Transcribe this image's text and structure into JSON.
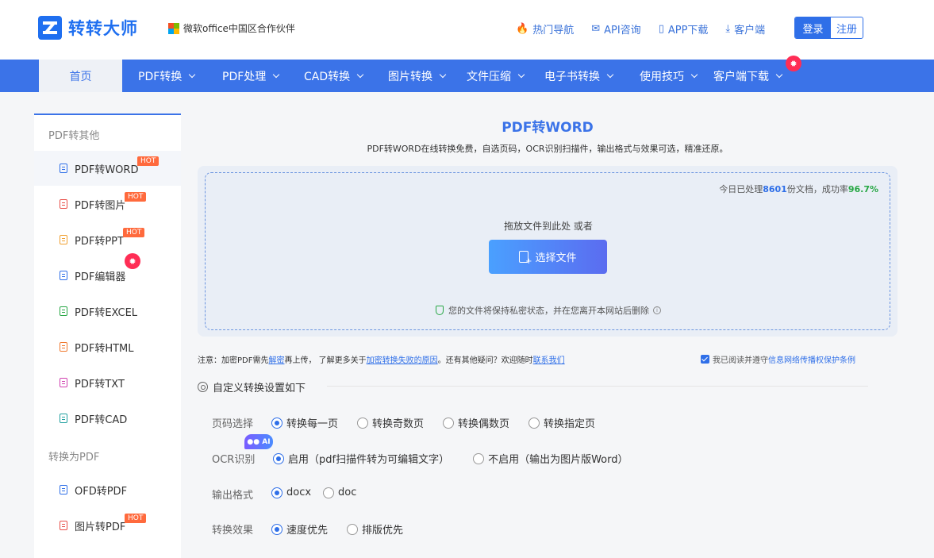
{
  "brand": {
    "name": "转转大师",
    "partner": "微软office中国区合作伙伴"
  },
  "toplinks": [
    {
      "icon": "fire-icon",
      "label": "热门导航"
    },
    {
      "icon": "chat-icon",
      "label": "API咨询"
    },
    {
      "icon": "phone-icon",
      "label": "APP下载"
    },
    {
      "icon": "download-icon",
      "label": "客户端"
    }
  ],
  "auth": {
    "login": "登录",
    "register": "注册"
  },
  "nav": {
    "home": "首页",
    "items": [
      "PDF转换",
      "PDF处理",
      "CAD转换",
      "图片转换",
      "文件压缩",
      "电子书转换",
      "使用技巧",
      "客户端下载"
    ]
  },
  "sidebar": {
    "group1": "PDF转其他",
    "items1": [
      {
        "label": "PDF转WORD",
        "badge": "HOT",
        "color": "#2f6fe8"
      },
      {
        "label": "PDF转图片",
        "badge": "HOT",
        "color": "#e8504a"
      },
      {
        "label": "PDF转PPT",
        "badge": "HOT",
        "color": "#f0a030"
      },
      {
        "label": "PDF编辑器",
        "badge": "fire",
        "color": "#2f6fe8"
      },
      {
        "label": "PDF转EXCEL",
        "badge": "",
        "color": "#28a745"
      },
      {
        "label": "PDF转HTML",
        "badge": "",
        "color": "#f07a30"
      },
      {
        "label": "PDF转TXT",
        "badge": "",
        "color": "#d040b0"
      },
      {
        "label": "PDF转CAD",
        "badge": "",
        "color": "#20a0a0"
      }
    ],
    "group2": "转换为PDF",
    "items2": [
      {
        "label": "OFD转PDF",
        "badge": "",
        "color": "#2f6fe8"
      },
      {
        "label": "图片转PDF",
        "badge": "HOT",
        "color": "#e8504a"
      }
    ]
  },
  "main": {
    "title": "PDF转WORD",
    "subtitle": "PDF转WORD在线转换免费，自选页码，OCR识别扫描件，输出格式与效果可选，精准还原。",
    "stats": {
      "prefix": "今日已处理",
      "count": "8601",
      "mid": "份文档，成功率",
      "rate": "96.7%"
    },
    "drop_text": "拖放文件到此处 或者",
    "choose_button": "选择文件",
    "privacy": "您的文件将保持私密状态，并在您离开本网站后删除",
    "notice": {
      "p1": "注意：加密PDF需先",
      "link1": "解密",
      "p2": "再上传， 了解更多关于",
      "link2": "加密转换失败的原因",
      "p3": "。还有其他疑问？欢迎随时",
      "link3": "联系我们"
    },
    "agree": {
      "text": "我已阅读并遵守",
      "link": "信息网络传播权保护条例"
    },
    "settings_title": "自定义转换设置如下",
    "ai_badge": "AI",
    "options": [
      {
        "label": "页码选择",
        "choices": [
          "转换每一页",
          "转换奇数页",
          "转换偶数页",
          "转换指定页"
        ],
        "selected": 0
      },
      {
        "label": "OCR识别",
        "choices": [
          "启用（pdf扫描件转为可编辑文字）",
          "不启用（输出为图片版Word）"
        ],
        "selected": 0
      },
      {
        "label": "输出格式",
        "choices": [
          "docx",
          "doc"
        ],
        "selected": 0
      },
      {
        "label": "转换效果",
        "choices": [
          "速度优先",
          "排版优先"
        ],
        "selected": 0
      }
    ]
  },
  "colors": {
    "primary": "#3b73e8",
    "accent_green": "#28a745",
    "hot": "#ff6a3d",
    "fire": "#ff2d55"
  }
}
